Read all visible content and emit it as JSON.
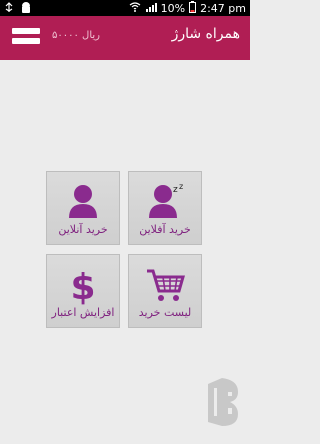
{
  "status_bar": {
    "time": "2:47 pm",
    "battery": "10%",
    "signal_icon": "signal-bars-icon",
    "wifi_icon": "wifi-icon",
    "battery_icon": "battery-icon",
    "usb_icon": "usb-icon",
    "android_icon": "android-icon"
  },
  "app_bar": {
    "title": "همراه شارژ",
    "balance": "۵۰۰۰۰ ریال"
  },
  "tiles": [
    {
      "label": "خرید آفلاین",
      "icon": "user-sleep-icon"
    },
    {
      "label": "خرید آنلاین",
      "icon": "user-icon"
    },
    {
      "label": "لیست خرید",
      "icon": "shopping-cart-icon"
    },
    {
      "label": "افزایش اعتبار",
      "icon": "dollar-icon"
    }
  ],
  "colors": {
    "brand": "#b01e54",
    "tile_label": "#7e1f7e",
    "icon": "#8a2b8e"
  }
}
